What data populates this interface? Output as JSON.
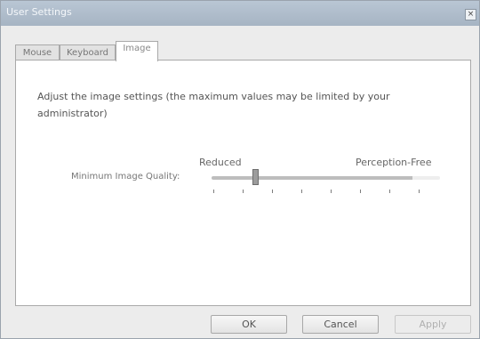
{
  "window": {
    "title": "User Settings",
    "close_glyph": "×"
  },
  "tabs": [
    {
      "label": "Mouse",
      "active": false
    },
    {
      "label": "Keyboard",
      "active": false
    },
    {
      "label": "Image",
      "active": true
    }
  ],
  "image_tab": {
    "description": "Adjust the image settings (the maximum values may be limited by your administrator)",
    "quality_label": "Minimum Image Quality:",
    "slider_min_label": "Reduced",
    "slider_max_label": "Perception-Free",
    "slider_position": "2 of 8",
    "slider_tick_count": 8
  },
  "buttons": {
    "ok": "OK",
    "cancel": "Cancel",
    "apply": "Apply"
  },
  "colors": {
    "titlebar": "#b1bfcd",
    "window_bg": "#ececec",
    "panel_bg": "#ffffff"
  }
}
